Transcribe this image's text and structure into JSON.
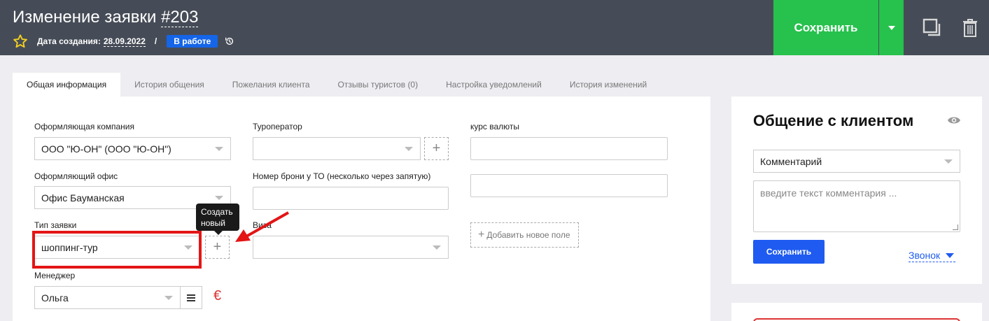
{
  "header": {
    "title_prefix": "Изменение заявки ",
    "title_number": "#203",
    "created_label": "Дата создания:",
    "created_date": "28.09.2022",
    "separator": "/",
    "status": "В работе",
    "save_label": "Сохранить",
    "icons": [
      "star-icon",
      "history-icon",
      "caret-down-icon",
      "copy-icon",
      "trash-icon"
    ]
  },
  "tabs": [
    {
      "label": "Общая информация",
      "active": true
    },
    {
      "label": "История общения",
      "active": false
    },
    {
      "label": "Пожелания клиента",
      "active": false
    },
    {
      "label": "Отзывы туристов (0)",
      "active": false
    },
    {
      "label": "Настройка уведомлений",
      "active": false
    },
    {
      "label": "История изменений",
      "active": false
    }
  ],
  "form": {
    "company_label": "Оформляющая компания",
    "company_value": "ООО \"Ю-ОН\" (ООО \"Ю-ОН\")",
    "office_label": "Оформляющий офис",
    "office_value": "Офис Бауманская",
    "type_label": "Тип заявки",
    "type_value": "шоппинг-тур",
    "manager_label": "Менеджер",
    "manager_value": "Ольга",
    "operator_label": "Туроператор",
    "booking_label": "Номер брони у ТО (несколько через запятую)",
    "visa_label": "Виза",
    "currency_label": "курс валюты",
    "add_field_label": "Добавить новое поле",
    "tooltip": "Создать новый",
    "plus": "+",
    "euro": "€"
  },
  "right_panel": {
    "title": "Общение с клиентом",
    "type_value": "Комментарий",
    "comment_placeholder": "введите текст комментария ...",
    "save_label": "Сохранить",
    "call_label": "Звонок"
  },
  "colors": {
    "header_bg": "#464c57",
    "save_green": "#27c14d",
    "status_blue": "#1565e8",
    "primary_blue": "#1f5bf0",
    "highlight_red": "#e31515"
  }
}
